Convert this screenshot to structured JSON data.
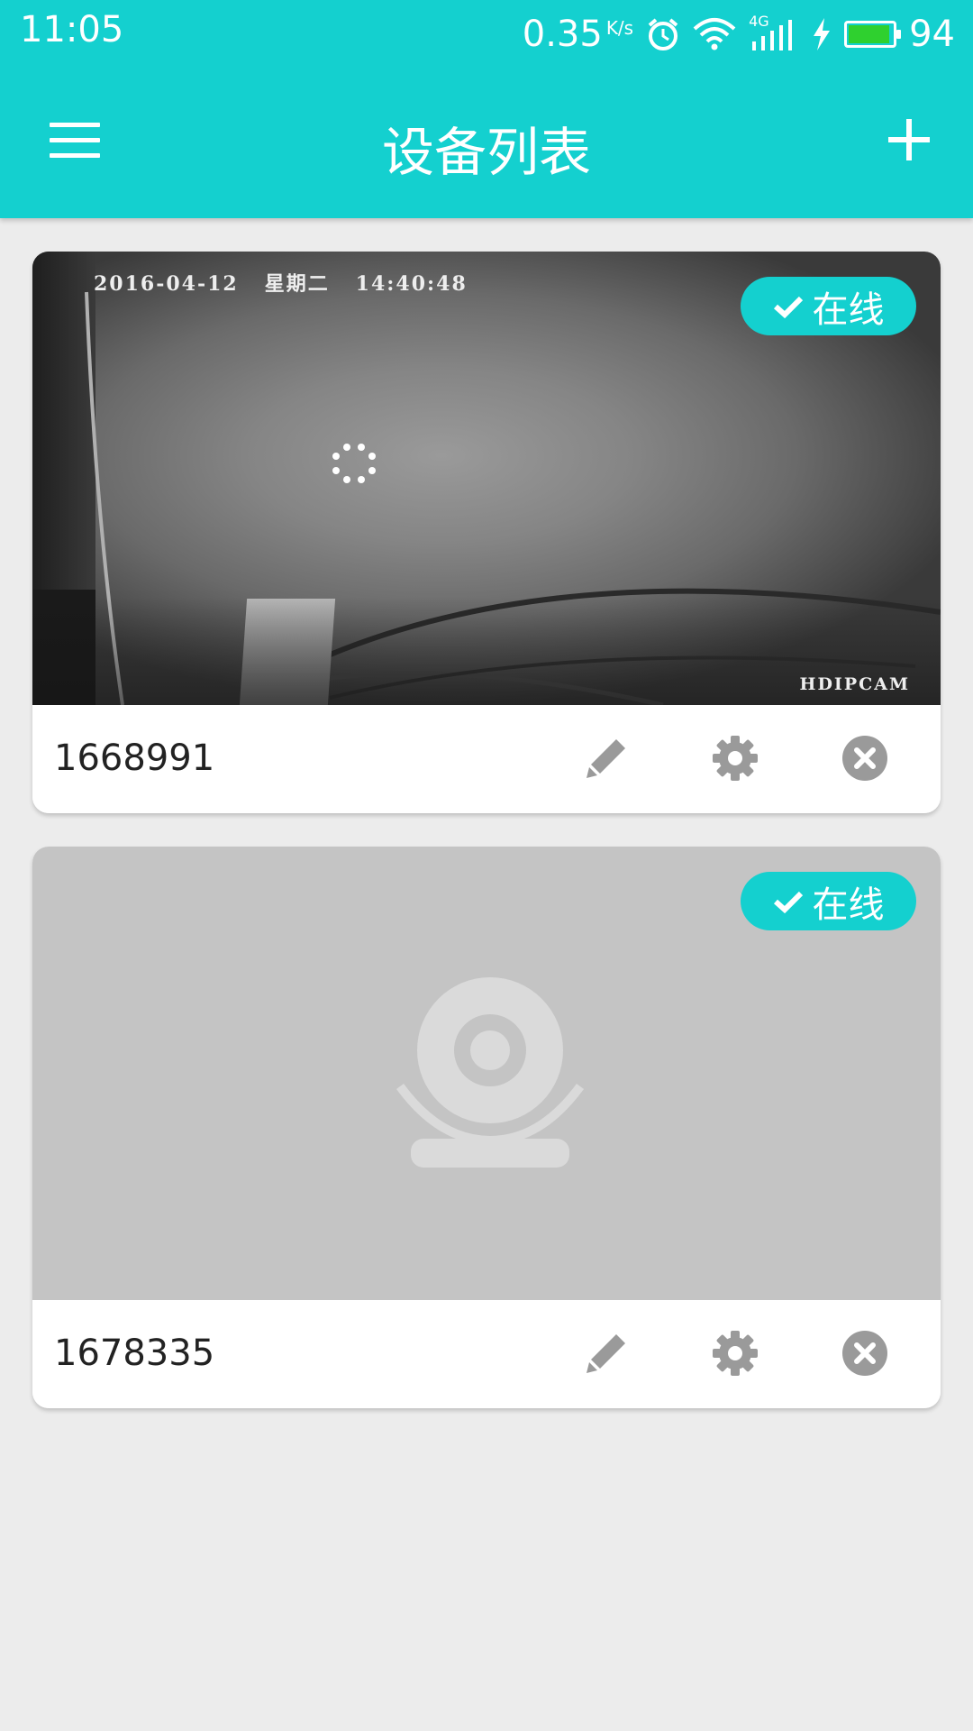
{
  "status_bar": {
    "time": "11:05",
    "speed_value": "0.35",
    "speed_unit": "K/s",
    "network_label": "4G",
    "battery_level": "94",
    "battery_fraction": 0.94
  },
  "header": {
    "title": "设备列表"
  },
  "colors": {
    "accent": "#14d0cf",
    "background": "#ececec",
    "icon_gray": "#9a9a9a"
  },
  "devices": [
    {
      "id": "1668991",
      "status": "在线",
      "preview": {
        "overlay_datetime": "2016-04-12   星期二   14:40:48",
        "watermark": "HDIPCAM"
      },
      "actions": [
        "pencil-icon",
        "gear-icon",
        "close-circle-icon"
      ]
    },
    {
      "id": "1678335",
      "status": "在线",
      "preview": null,
      "actions": [
        "pencil-icon",
        "gear-icon",
        "close-circle-icon"
      ]
    }
  ]
}
